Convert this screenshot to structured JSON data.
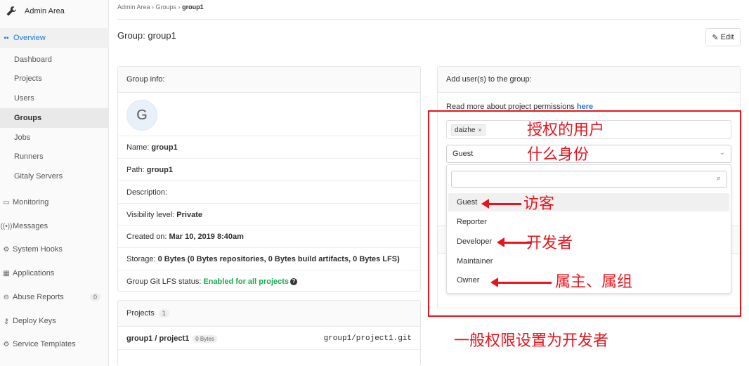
{
  "sidebar": {
    "title": "Admin Area",
    "overview": "Overview",
    "sub_items": [
      "Dashboard",
      "Projects",
      "Users",
      "Groups",
      "Jobs",
      "Runners",
      "Gitaly Servers"
    ],
    "items": [
      {
        "label": "Monitoring",
        "icon": "monitor-icon"
      },
      {
        "label": "Messages",
        "icon": "broadcast-icon"
      },
      {
        "label": "System Hooks",
        "icon": "hook-icon"
      },
      {
        "label": "Applications",
        "icon": "grid-icon"
      },
      {
        "label": "Abuse Reports",
        "icon": "flag-icon",
        "badge": "0"
      },
      {
        "label": "Deploy Keys",
        "icon": "key-icon"
      },
      {
        "label": "Service Templates",
        "icon": "settings-icon"
      }
    ]
  },
  "breadcrumb": {
    "item1": "Admin Area",
    "item2": "Groups",
    "item3": "group1"
  },
  "page": {
    "title": "Group: group1",
    "edit_label": "Edit"
  },
  "group_info": {
    "header": "Group info:",
    "avatar_letter": "G",
    "name_label": "Name:",
    "name_value": "group1",
    "path_label": "Path:",
    "path_value": "group1",
    "description_label": "Description:",
    "visibility_label": "Visibility level:",
    "visibility_value": "Private",
    "created_label": "Created on:",
    "created_value": "Mar 10, 2019 8:40am",
    "storage_label": "Storage:",
    "storage_value": "0 Bytes (0 Bytes repositories, 0 Bytes build artifacts, 0 Bytes LFS)",
    "lfs_label": "Group Git LFS status:",
    "lfs_value": "Enabled for all projects"
  },
  "projects": {
    "header": "Projects",
    "count": "1",
    "project_name": "group1 / project1",
    "project_size": "0 Bytes",
    "project_git": "group1/project1.git"
  },
  "add_users": {
    "header": "Add user(s) to the group:",
    "permissions_text": "Read more about project permissions",
    "permissions_link": "here",
    "token_user": "daizhe",
    "selected_role": "Guest",
    "roles": [
      "Guest",
      "Reporter",
      "Developer",
      "Maintainer",
      "Owner"
    ]
  },
  "annotations": {
    "line1": "授权的用户",
    "line2": "什么身份",
    "guest_note": "访客",
    "developer_note": "开发者",
    "owner_note": "属主、属组",
    "bottom_note": "一般权限设置为开发者",
    "color": "#e8141c"
  }
}
